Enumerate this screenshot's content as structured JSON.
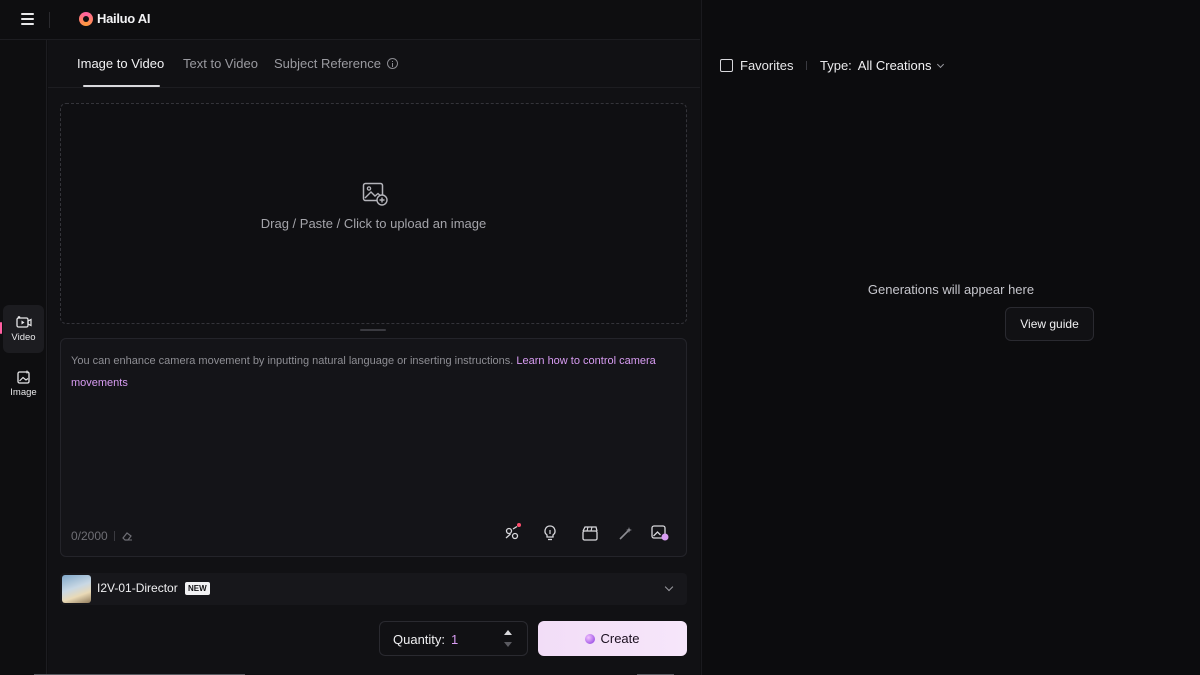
{
  "header": {
    "logo_text": "Hailuo AI"
  },
  "rail": {
    "items": [
      {
        "label": "Video",
        "icon": "video-icon",
        "active": true
      },
      {
        "label": "Image",
        "icon": "image-icon",
        "active": false
      }
    ]
  },
  "tabs": [
    {
      "label": "Image to Video",
      "active": true
    },
    {
      "label": "Text to Video",
      "active": false
    },
    {
      "label": "Subject Reference",
      "active": false
    }
  ],
  "upload": {
    "text": "Drag / Paste / Click to upload an image"
  },
  "prompt": {
    "placeholder": "You can enhance camera movement by inputting natural language or inserting instructions.",
    "link_text": "Learn how to control camera movements",
    "counter": "0/2000"
  },
  "model": {
    "name": "I2V-01-Director",
    "badge": "NEW"
  },
  "quantity": {
    "label": "Quantity:",
    "value": "1"
  },
  "create": {
    "label": "Create"
  },
  "gallery": {
    "favorites_label": "Favorites",
    "type_label": "Type:",
    "type_value": "All Creations",
    "empty_text": "Generations will appear here",
    "guide_label": "View guide"
  },
  "colors": {
    "accent": "#d89cf2",
    "create_bg": "#f2ddf7",
    "rail_accent": "#ff5fa2"
  }
}
